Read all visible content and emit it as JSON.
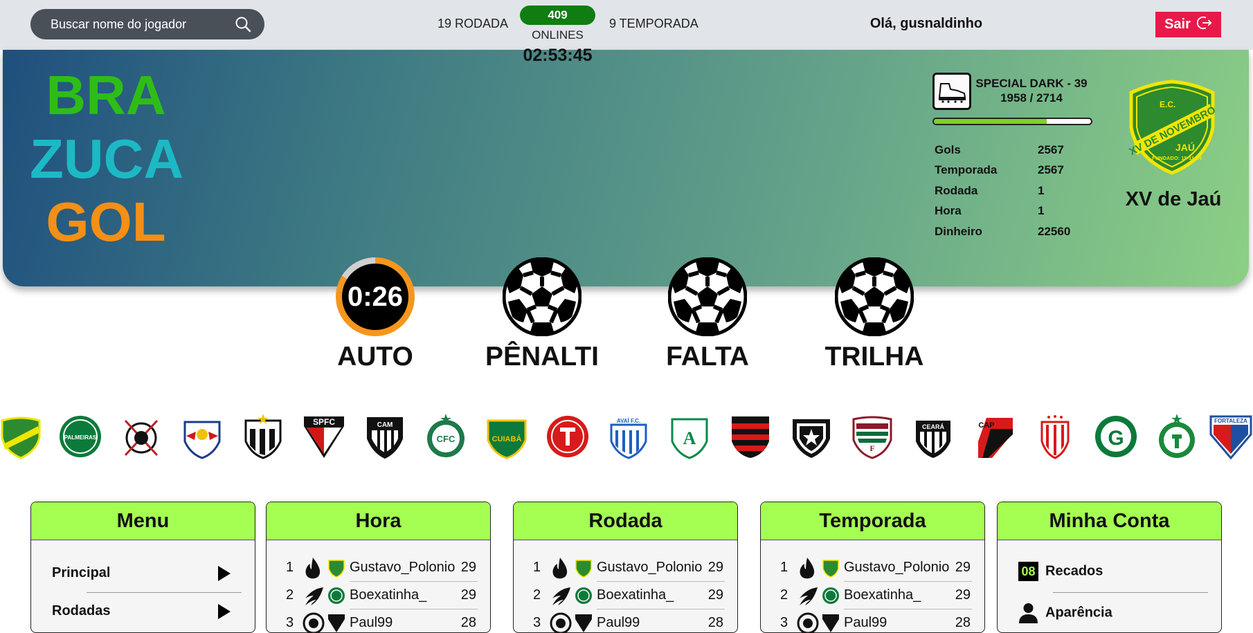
{
  "search": {
    "placeholder": "Buscar nome do jogador"
  },
  "header": {
    "round": "19 RODADA",
    "season": "9 TEMPORADA",
    "online_count": "409",
    "online_label": "ONLINES",
    "clock": "02:53:45",
    "greeting": "Olá, gusnaldinho",
    "logout_label": "Sair"
  },
  "brand": {
    "line1": "BRA",
    "line2": "ZUCA",
    "line3": "GOL"
  },
  "player": {
    "item_name": "SPECIAL DARK - 39",
    "item_progress": "1958 / 2714",
    "progress_fraction": 0.72,
    "stats": [
      {
        "label": "Gols",
        "value": "2567"
      },
      {
        "label": "Temporada",
        "value": "2567"
      },
      {
        "label": "Rodada",
        "value": "1"
      },
      {
        "label": "Hora",
        "value": "1"
      },
      {
        "label": "Dinheiro",
        "value": "22560"
      }
    ],
    "club_name": "XV de Jaú",
    "club_crest_text": {
      "top": "E.C.",
      "band": "XV DE NOVEMBRO",
      "city": "JAÚ",
      "founded": "FUNDADO: 15-11-24"
    }
  },
  "modes": {
    "auto_timer": "0:26",
    "auto_progress": 0.84,
    "auto_label": "AUTO",
    "penalti_label": "PÊNALTI",
    "falta_label": "FALTA",
    "trilha_label": "TRILHA"
  },
  "teams": [
    "xv-de-jau",
    "palmeiras",
    "corinthians",
    "red-bull-bragantino",
    "santos",
    "sao-paulo",
    "atletico-mineiro",
    "coritiba",
    "cuiaba",
    "internacional",
    "avai",
    "america-mineiro",
    "flamengo",
    "botafogo",
    "fluminense",
    "ceara",
    "athletico-paranaense",
    "atletico-goianiense",
    "goias",
    "juventude",
    "fortaleza"
  ],
  "team_texts": {
    "palmeiras": "PALMEIRAS",
    "saopaulo": "SPFC",
    "atletico_mineiro": "CAM",
    "coritiba": "CFC",
    "cuiaba": "CUIABÁ",
    "avai": "AVAÍ F.C.",
    "ceara": "CEARÁ",
    "athletico": "CAP",
    "goias": "G",
    "fortaleza": "FORTALEZA"
  },
  "panels": {
    "menu": {
      "title": "Menu",
      "items": [
        "Principal",
        "Rodadas"
      ]
    },
    "hora": {
      "title": "Hora",
      "rows": [
        {
          "pos": "1",
          "name": "Gustavo_Polonio",
          "pts": "29"
        },
        {
          "pos": "2",
          "name": "Boexatinha_",
          "pts": "29"
        },
        {
          "pos": "3",
          "name": "Paul99",
          "pts": "28"
        }
      ]
    },
    "rodada": {
      "title": "Rodada",
      "rows": [
        {
          "pos": "1",
          "name": "Gustavo_Polonio",
          "pts": "29"
        },
        {
          "pos": "2",
          "name": "Boexatinha_",
          "pts": "29"
        },
        {
          "pos": "3",
          "name": "Paul99",
          "pts": "28"
        }
      ]
    },
    "temporada": {
      "title": "Temporada",
      "rows": [
        {
          "pos": "1",
          "name": "Gustavo_Polonio",
          "pts": "29"
        },
        {
          "pos": "2",
          "name": "Boexatinha_",
          "pts": "29"
        },
        {
          "pos": "3",
          "name": "Paul99",
          "pts": "28"
        }
      ]
    },
    "conta": {
      "title": "Minha Conta",
      "badge": "08",
      "items": [
        "Recados",
        "Aparência"
      ]
    }
  },
  "colors": {
    "accent_green": "#a5ff52",
    "logout_red": "#e8194a",
    "online_green": "#0f7d12",
    "brand_green": "#2ebd16",
    "brand_cyan": "#1cb9c4",
    "brand_orange": "#f58f15"
  }
}
